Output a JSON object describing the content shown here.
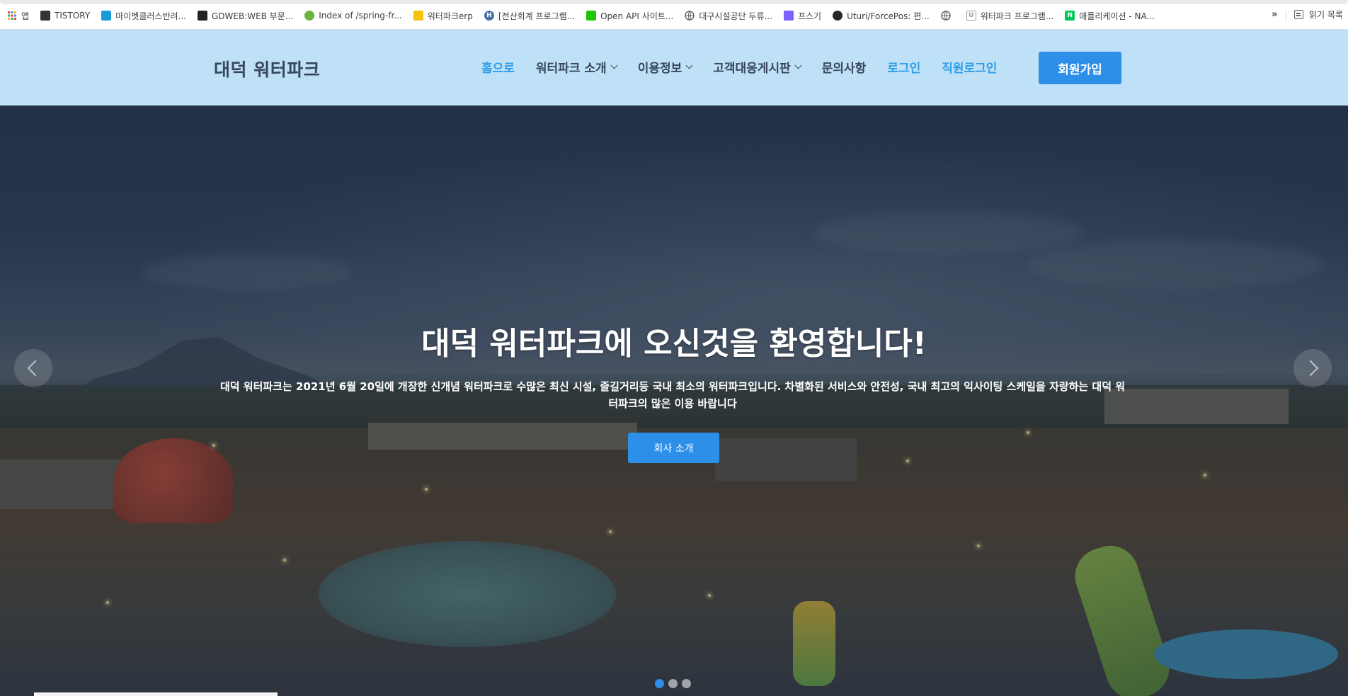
{
  "bookmarks": {
    "items": [
      {
        "label": "앱",
        "icon": "apps-grid-icon",
        "color": "#ea4335"
      },
      {
        "label": "TISTORY",
        "icon": "tistory-icon",
        "color": "#333333"
      },
      {
        "label": "마이펫클러스반려...",
        "icon": "paw-icon",
        "color": "#1a9ad6"
      },
      {
        "label": "GDWEB:WEB 부문...",
        "icon": "music-note-icon",
        "color": "#222222"
      },
      {
        "label": "Index of /spring-fr...",
        "icon": "spring-leaf-icon",
        "color": "#6db33f"
      },
      {
        "label": "워터파크erp",
        "icon": "grid-yellow-icon",
        "color": "#f4c20d"
      },
      {
        "label": "[전산회계 프로그램...",
        "icon": "h-circle-icon",
        "color": "#4a6fa5"
      },
      {
        "label": "Open API 사이트...",
        "icon": "chat-green-icon",
        "color": "#1ec800"
      },
      {
        "label": "대구시설공단 두류...",
        "icon": "globe-icon",
        "color": "#5f6368"
      },
      {
        "label": "프스기",
        "icon": "d-logo-icon",
        "color": "#7b61ff"
      },
      {
        "label": "Uturi/ForcePos: 편...",
        "icon": "github-icon",
        "color": "#24292e"
      },
      {
        "label": "",
        "icon": "globe-icon",
        "color": "#5f6368"
      },
      {
        "label": "워터파크 프로그램...",
        "icon": "u-shield-icon",
        "color": "#9aa0a6"
      },
      {
        "label": "애플리케이션 - NA...",
        "icon": "naver-n-icon",
        "color": "#03c75a"
      }
    ],
    "more": "»",
    "reading_list": "읽기 목록"
  },
  "header": {
    "logo": "대덕 워터파크",
    "nav": [
      {
        "label": "홈으로",
        "dropdown": false,
        "style": "active"
      },
      {
        "label": "워터파크 소개",
        "dropdown": true,
        "style": "normal"
      },
      {
        "label": "이용정보",
        "dropdown": true,
        "style": "normal"
      },
      {
        "label": "고객대응게시판",
        "dropdown": true,
        "style": "normal"
      },
      {
        "label": "문의사항",
        "dropdown": false,
        "style": "normal"
      },
      {
        "label": "로그인",
        "dropdown": false,
        "style": "blue"
      },
      {
        "label": "직원로그인",
        "dropdown": false,
        "style": "blue"
      }
    ],
    "signup": "회원가입"
  },
  "hero": {
    "title": "대덕 워터파크에 오신것을 환영합니다!",
    "description": "대덕 워터파크는 2021년 6월 20일에 개장한 신개념 워터파크로 수많은 최신 시설, 즐길거리등 국내 최소의 워터파크입니다. 차별화된 서비스와 안전성, 국내 최고의 익사이팅 스케일을 자랑하는 대덕 워터파크의 많은 이용 바랍니다",
    "button": "회사 소개",
    "slides_total": 3,
    "active_slide": 1
  },
  "colors": {
    "header_bg": "#bfe1f8",
    "accent": "#2e8fe8",
    "nav_text": "#37475a"
  }
}
